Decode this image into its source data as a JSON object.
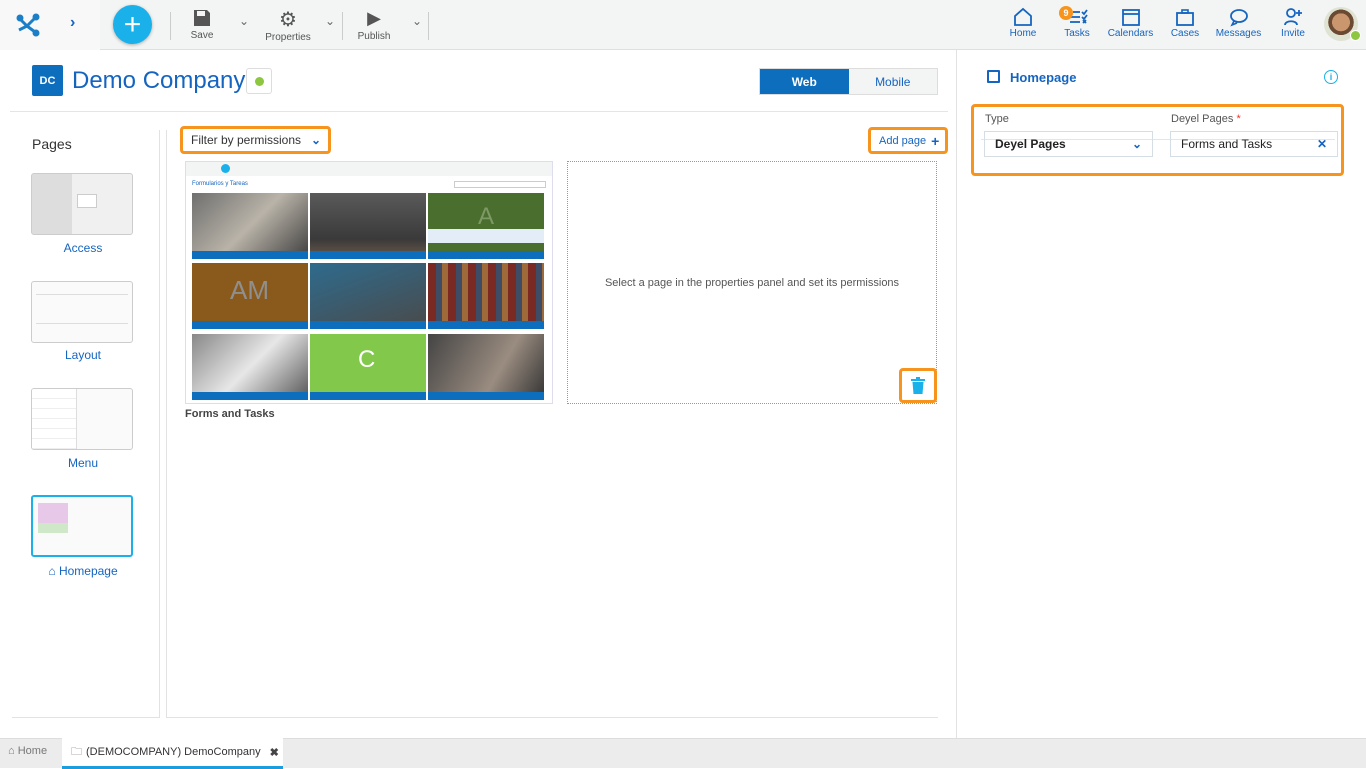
{
  "toolbar": {
    "save": "Save",
    "properties": "Properties",
    "publish": "Publish"
  },
  "nav": [
    {
      "label": "Home",
      "icon": "home-icon"
    },
    {
      "label": "Tasks",
      "icon": "tasks-icon",
      "badge": "9"
    },
    {
      "label": "Calendars",
      "icon": "calendar-icon"
    },
    {
      "label": "Cases",
      "icon": "briefcase-icon"
    },
    {
      "label": "Messages",
      "icon": "message-icon"
    },
    {
      "label": "Invite",
      "icon": "invite-user-icon"
    }
  ],
  "app": {
    "initials": "DC",
    "title": "Demo Company",
    "status_color": "#8dc63f"
  },
  "view_toggle": {
    "web": "Web",
    "mobile": "Mobile",
    "active": "Web"
  },
  "pages": {
    "heading": "Pages",
    "items": [
      {
        "label": "Access"
      },
      {
        "label": "Layout"
      },
      {
        "label": "Menu"
      },
      {
        "label": "Homepage",
        "selected": true
      }
    ]
  },
  "filter": {
    "label": "Filter by permissions"
  },
  "add_page": "Add page",
  "preview": {
    "title": "Formularios y Tareas",
    "caption": "Forms and Tasks",
    "tile_letters": [
      "A",
      "AM",
      "C"
    ]
  },
  "empty_slot": "Select a page in the properties panel and set its permissions",
  "properties": {
    "title": "Homepage",
    "type_label": "Type",
    "type_value": "Deyel Pages",
    "pages_label": "Deyel Pages",
    "required": "*",
    "pages_value": "Forms and Tasks"
  },
  "tabs": [
    {
      "label": "Home"
    },
    {
      "label": "(DEMOCOMPANY) DemoCompany"
    }
  ],
  "colors": {
    "accent": "#0d6ebd",
    "highlight": "#f7941d",
    "add": "#1ab0ea"
  }
}
